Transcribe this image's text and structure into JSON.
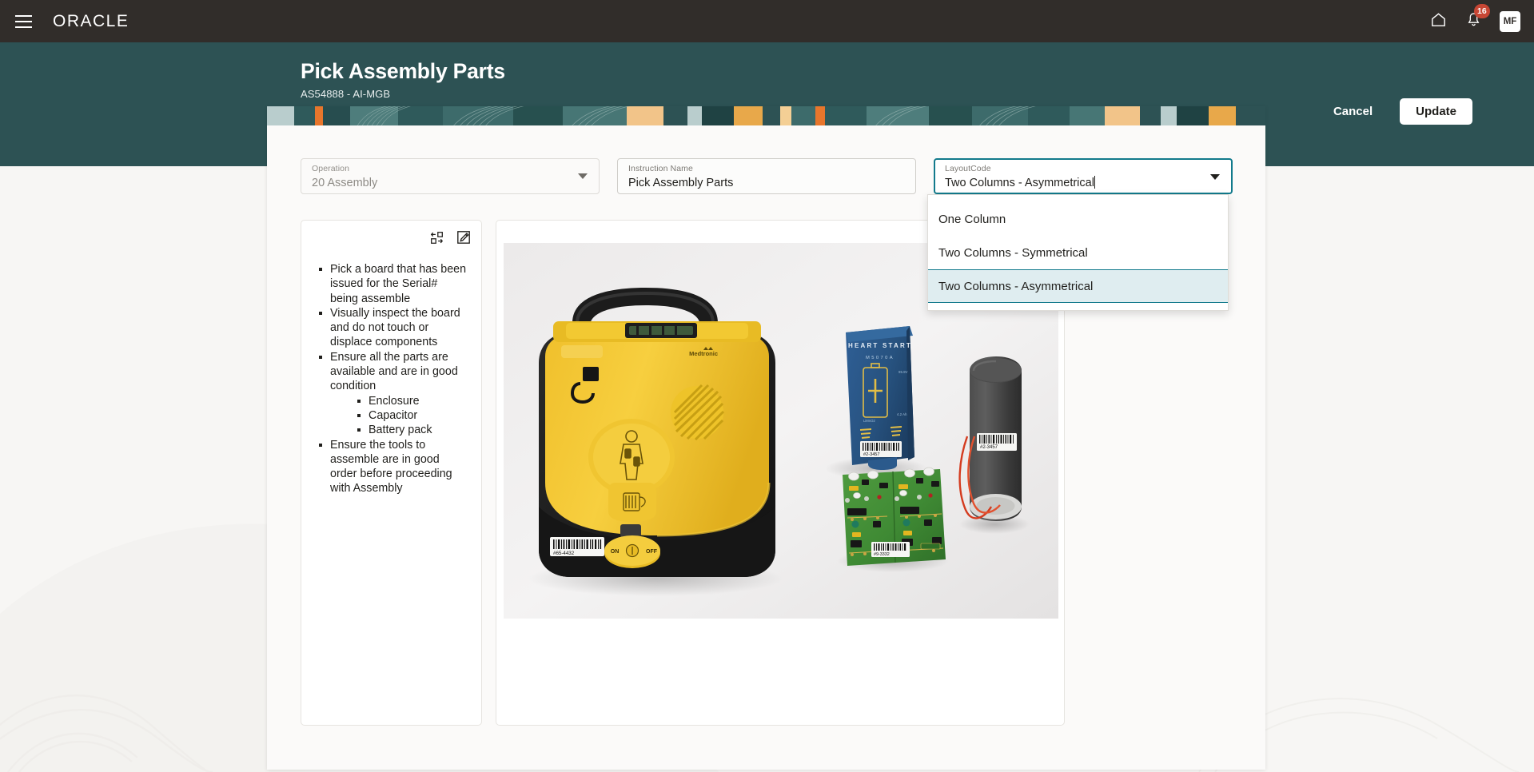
{
  "global_header": {
    "logo_text": "ORACLE",
    "menu_icon": "hamburger-menu-icon",
    "home_icon": "home-icon",
    "notification_icon": "bell-icon",
    "notification_count": "16",
    "avatar_initials": "MF",
    "background_color": "#312d2a"
  },
  "page_header": {
    "title": "Pick Assembly Parts",
    "subtitle": "AS54888 - AI-MGB",
    "background_color": "#2d5254",
    "cancel_label": "Cancel",
    "update_label": "Update"
  },
  "form": {
    "operation": {
      "label": "Operation",
      "value": "20 Assembly",
      "placeholder": "Select operation",
      "disabled": true,
      "icon": "chevron-down-icon"
    },
    "instruction_name": {
      "label": "Instruction Name",
      "value": "Pick Assembly Parts",
      "placeholder": "Enter instruction name"
    },
    "layout_code": {
      "label": "LayoutCode",
      "value": "Two Columns - Asymmetrical",
      "placeholder": "Select layout",
      "focused": true,
      "icon": "chevron-down-icon"
    }
  },
  "dropdown": {
    "options": [
      {
        "label": "One Column",
        "selected": false
      },
      {
        "label": "Two Columns - Symmetrical",
        "selected": false
      },
      {
        "label": "Two Columns - Asymmetrical",
        "selected": true
      }
    ],
    "highlight_color": "#dfedf0",
    "highlight_border_color": "#127a8c"
  },
  "panels": {
    "text_panel": {
      "reorder_icon": "move-reorder-icon",
      "edit_icon": "edit-pencil-square-icon",
      "bullets": [
        {
          "text": "Pick a board that has been issued for the Serial# being assemble",
          "children": []
        },
        {
          "text": "Visually inspect the board and do not touch or displace components",
          "children": []
        },
        {
          "text": "Ensure all the parts are available and are in good condition",
          "children": [
            "Enclosure",
            "Capacitor",
            "Battery pack"
          ]
        },
        {
          "text": "Ensure the tools to assemble are in good order before proceeding with Assembly",
          "children": []
        }
      ]
    },
    "image_panel": {
      "alt": "Automated external defibrillator with battery pack, circuit boards and capacitor",
      "labels": {
        "battery_brand": "HEART START",
        "battery_model": "M5070A",
        "device_brand": "Medtronic",
        "switch_on": "ON",
        "switch_off": "OFF",
        "barcode_device": "#65-4432",
        "barcode_battery": "#2-3457",
        "barcode_capacitor": "#2-3457",
        "barcode_board": "#9-3332"
      }
    }
  },
  "theme": {
    "accent_teal": "#2d5254",
    "focus_teal": "#127a8c",
    "brand_red": "#c74634",
    "page_background": "#f7f6f4",
    "card_background": "#fbfaf9"
  }
}
